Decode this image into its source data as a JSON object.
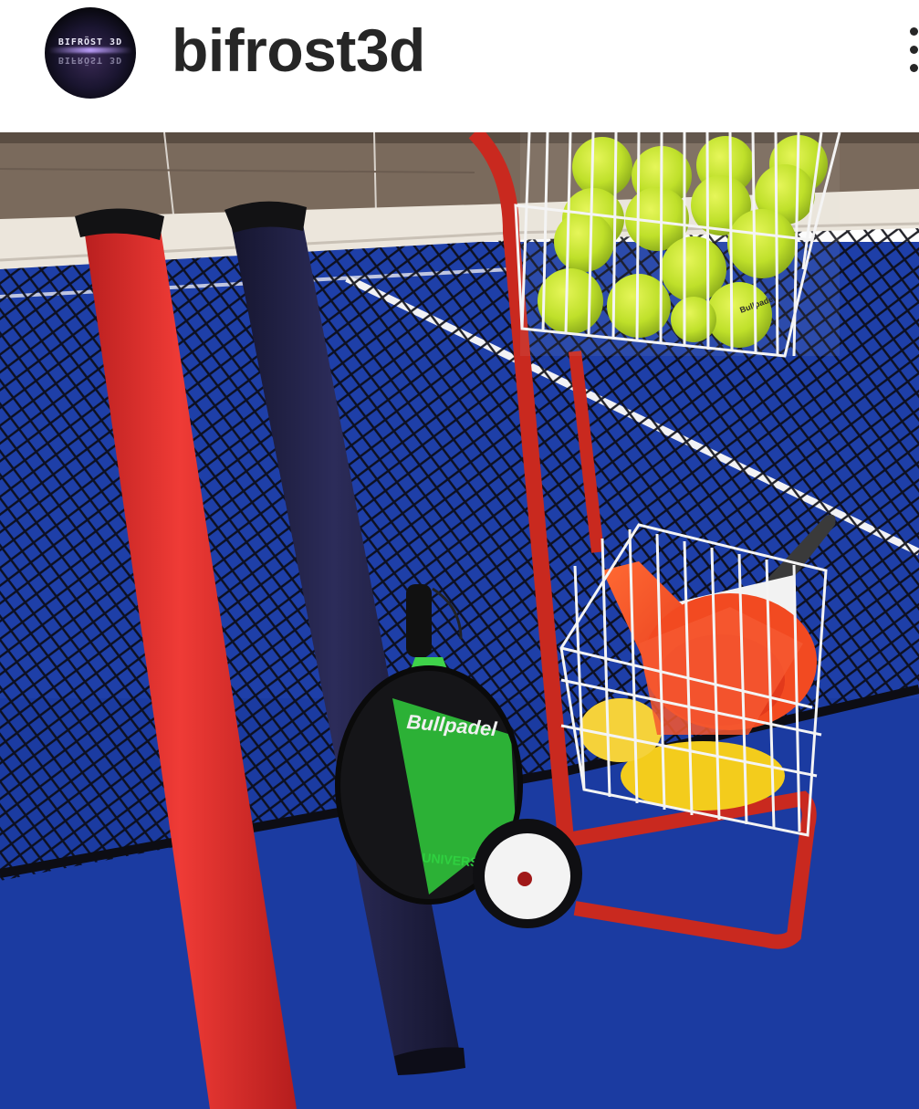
{
  "post": {
    "username": "bifrost3d",
    "avatar": {
      "logo_text": "BIFRÖST 3D",
      "logo_mirror_text": "BIFRÖST 3D"
    },
    "more_icon": "more-options-icon"
  },
  "photo": {
    "ball_print": "Bullpadel",
    "racket_brand": "Bullpadel",
    "racket_lower_text": "UNIVERSAL",
    "colors": {
      "court_blue": "#1d3fa6",
      "red_tube": "#e2332f",
      "navy_tube": "#22224a",
      "ball_green": "#c8e62e",
      "cart_red": "#c9291f",
      "cone_red": "#f24a21",
      "disc_yellow": "#f3cc1c",
      "racket_green": "#3fd34a"
    }
  }
}
